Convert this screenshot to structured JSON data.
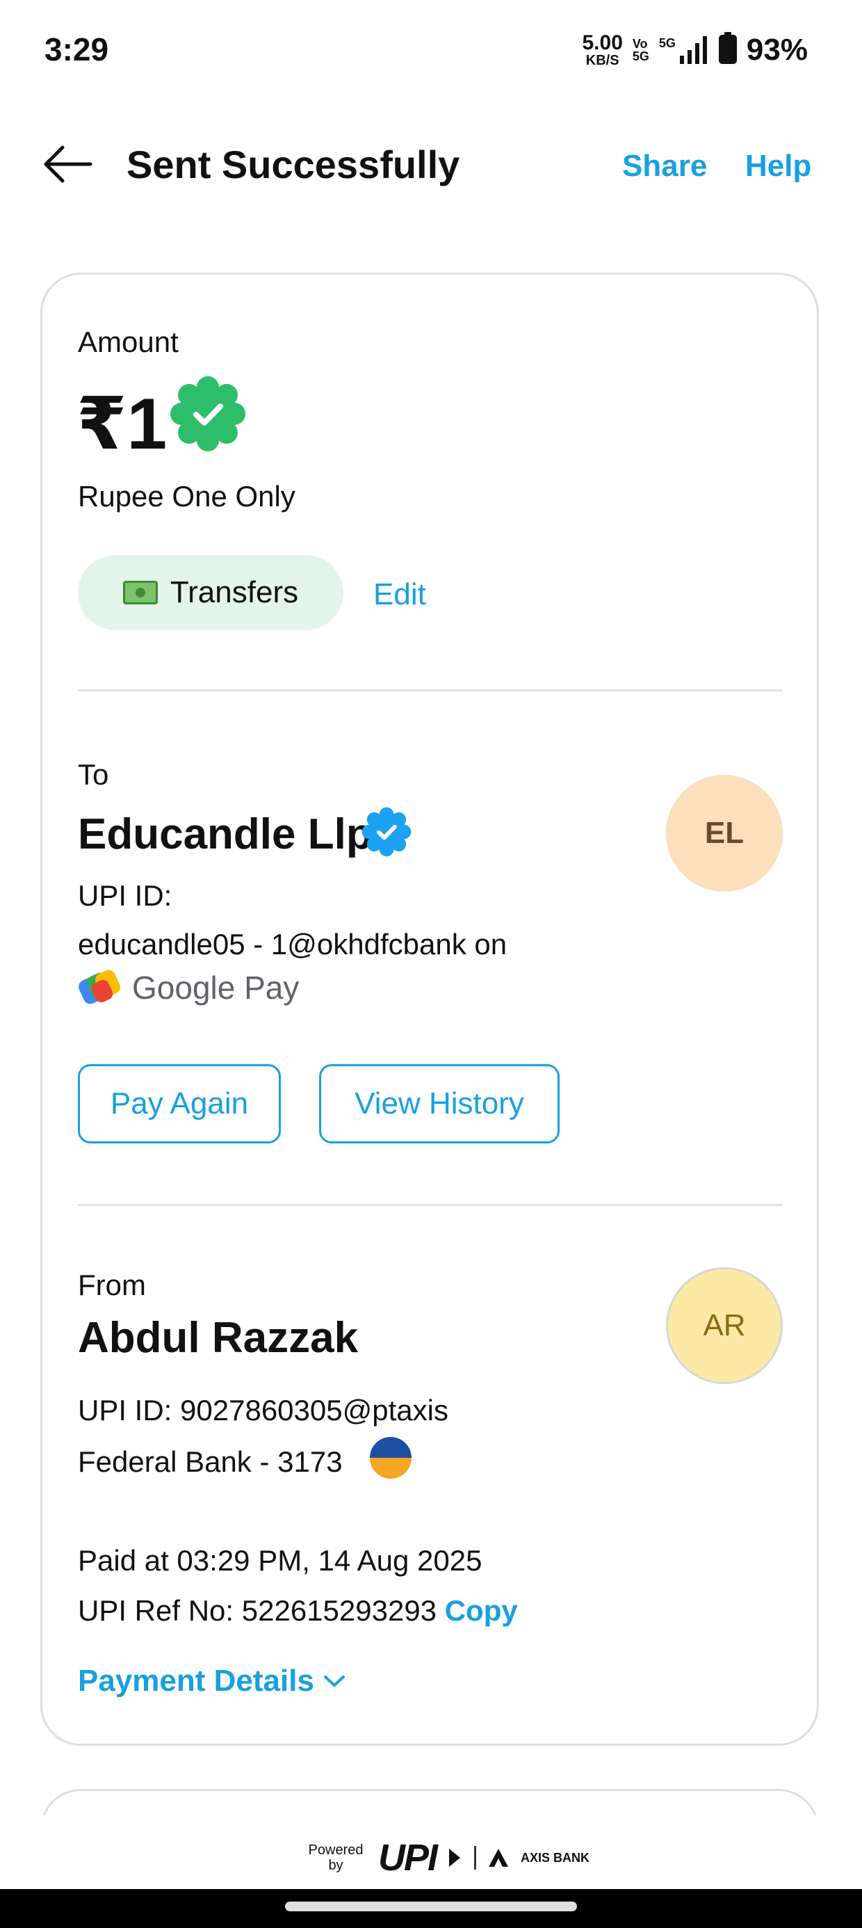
{
  "status_bar": {
    "time": "3:29",
    "net_speed_value": "5.00",
    "net_speed_unit": "KB/S",
    "volte_top": "Vo",
    "volte_bottom": "5G",
    "signal_label": "5G",
    "battery": "93%"
  },
  "header": {
    "title": "Sent Successfully",
    "share": "Share",
    "help": "Help"
  },
  "amount": {
    "label": "Amount",
    "value": "₹1",
    "words": "Rupee One Only",
    "category": "Transfers",
    "edit": "Edit"
  },
  "to": {
    "label": "To",
    "name": "Educandle Llp",
    "upi_label": "UPI ID:",
    "upi_id": "educandle05 - 1@okhdfcbank on",
    "app": "Google Pay",
    "avatar": "EL",
    "pay_again": "Pay Again",
    "view_history": "View History"
  },
  "from": {
    "label": "From",
    "name": "Abdul Razzak",
    "upi": "UPI ID: 9027860305@ptaxis",
    "bank": "Federal Bank - 3173",
    "avatar": "AR"
  },
  "details": {
    "paid_at": "Paid at 03:29 PM, 14 Aug 2025",
    "ref": "UPI Ref No: 522615293293",
    "copy": "Copy",
    "payment_details": "Payment Details"
  },
  "footer": {
    "powered_by": "Powered by",
    "upi": "UPI",
    "bank": "AXIS BANK"
  },
  "colors": {
    "accent": "#18a0e0",
    "success_green": "#2ebd6b",
    "verified_blue": "#1da1f2"
  }
}
